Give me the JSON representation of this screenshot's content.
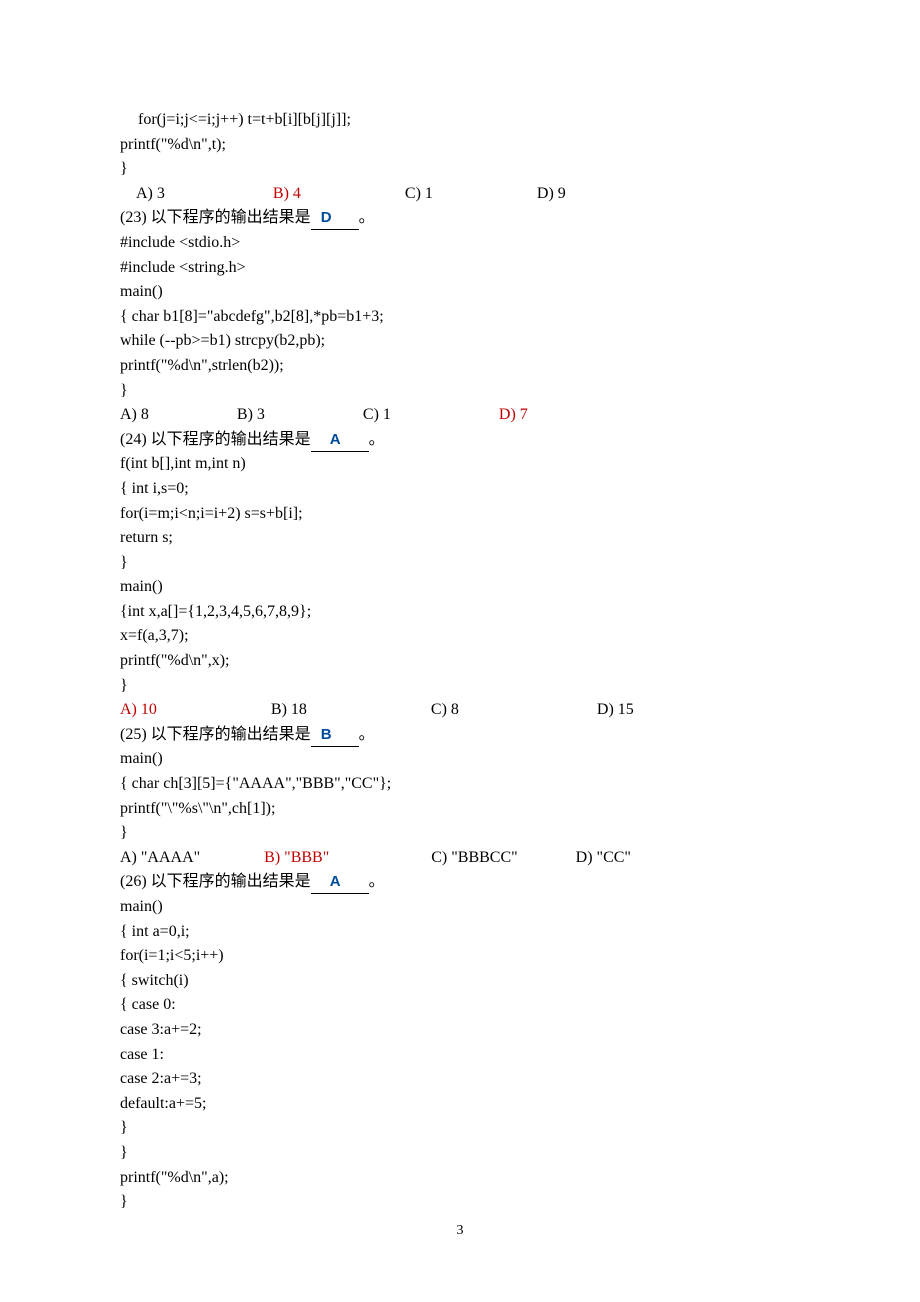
{
  "pageNumber": "3",
  "block1": {
    "l1": "for(j=i;j<=i;j++) t=t+b[i][b[j][j]];",
    "l2": "printf(\"%d\\n\",t);",
    "l3": "}",
    "opts": {
      "a": "A) 3",
      "b": "B) 4",
      "c": "C) 1",
      "d": "D) 9"
    }
  },
  "q23": {
    "stem1": "(23)  以下程序的输出结果是",
    "stem2": "。",
    "ans": "D",
    "l1": "#include    <stdio.h>",
    "l2": "#include    <string.h>",
    "l3": "main()",
    "l4": "{    char    b1[8]=\"abcdefg\",b2[8],*pb=b1+3;",
    "l5": "while (--pb>=b1)    strcpy(b2,pb);",
    "l6": "printf(\"%d\\n\",strlen(b2));",
    "l7": "}",
    "opts": {
      "a": "A) 8",
      "b": "B) 3",
      "c": "C) 1",
      "d": "D) 7"
    }
  },
  "q24": {
    "stem1": "(24)  以下程序的输出结果是",
    "stem2": "。",
    "ans": "A",
    "l1": "f(int    b[],int    m,int    n)",
    "l2": "{ int    i,s=0;",
    "l3": "for(i=m;i<n;i=i+2)    s=s+b[i];",
    "l4": "return    s;",
    "l5": "}",
    "l6": "main()",
    "l7": "{int    x,a[]={1,2,3,4,5,6,7,8,9};",
    "l8": "x=f(a,3,7);",
    "l9": "printf(\"%d\\n\",x);",
    "l10": "}",
    "opts": {
      "a": "A) 10",
      "b": "B) 18",
      "c": "C) 8",
      "d": "D) 15"
    }
  },
  "q25": {
    "stem1": "(25)  以下程序的输出结果是",
    "stem2": "。",
    "ans": "B",
    "l1": "main()",
    "l2": "{    char     ch[3][5]={\"AAAA\",\"BBB\",\"CC\"};",
    "l3": "printf(\"\\\"%s\\\"\\n\",ch[1]);",
    "l4": "}",
    "opts": {
      "a": "A) \"AAAA\"",
      "b": "B) \"BBB\"",
      "c": "C) \"BBBCC\"",
      "d": "D) \"CC\""
    }
  },
  "q26": {
    "stem1": "(26)  以下程序的输出结果是",
    "stem2": "。",
    "ans": "A",
    "l1": "main()",
    "l2": "{ int    a=0,i;",
    "l3": "for(i=1;i<5;i++)",
    "l4": "{    switch(i)",
    "l5": "{ case 0:",
    "l6": "case 3:a+=2;",
    "l7": "case 1:",
    "l8": "case 2:a+=3;",
    "l9": "default:a+=5;",
    "l10": "}",
    "l11": "}",
    "l12": "printf(\"%d\\n\",a);",
    "l13": "}"
  }
}
